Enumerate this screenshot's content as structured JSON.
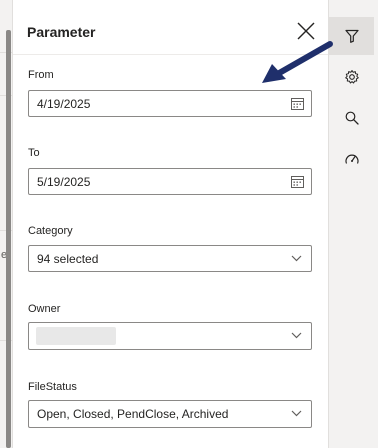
{
  "panel": {
    "title": "Parameter",
    "close_icon": "close-icon"
  },
  "fields": [
    {
      "label": "From",
      "value": "4/19/2025",
      "icon": "calendar-icon"
    },
    {
      "label": "To",
      "value": "5/19/2025",
      "icon": "calendar-icon"
    },
    {
      "label": "Category",
      "value": "94 selected",
      "icon": "chevron-down-icon"
    },
    {
      "label": "Owner",
      "value": "",
      "icon": "chevron-down-icon"
    },
    {
      "label": "FileStatus",
      "value": "Open, Closed, PendClose, Archived",
      "icon": "chevron-down-icon"
    }
  ],
  "background": {
    "fragment": "e"
  },
  "rail": {
    "items": [
      "filter-icon",
      "settings-icon",
      "search-icon",
      "performance-icon"
    ]
  },
  "colors": {
    "annotation_arrow": "#1f2f6b",
    "border": "#8a8886",
    "rail_background": "#f3f2f1"
  }
}
